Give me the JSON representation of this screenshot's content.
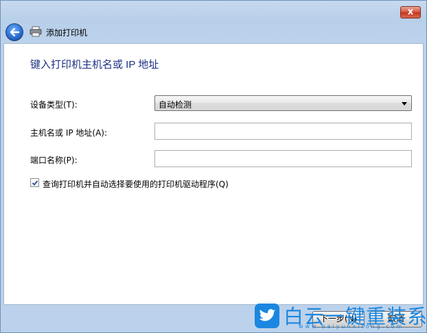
{
  "window": {
    "close_label": "x"
  },
  "nav": {
    "title": "添加打印机"
  },
  "main": {
    "heading": "键入打印机主机名或 IP 地址",
    "device_type": {
      "label": "设备类型(T):",
      "value": "自动检测"
    },
    "hostname": {
      "label": "主机名或 IP 地址(A):",
      "value": ""
    },
    "port_name": {
      "label": "端口名称(P):",
      "value": ""
    },
    "query_checkbox": {
      "label": "查询打印机并自动选择要使用的打印机驱动程序(Q)",
      "checked": true
    }
  },
  "footer": {
    "next_label": "下一步(N)",
    "cancel_label": "取消"
  },
  "watermark": {
    "text": "白云一键重装系统",
    "url": "www.baiyunxitong.com"
  },
  "colors": {
    "heading": "#1e3287",
    "watermark": "#1c87e0"
  }
}
